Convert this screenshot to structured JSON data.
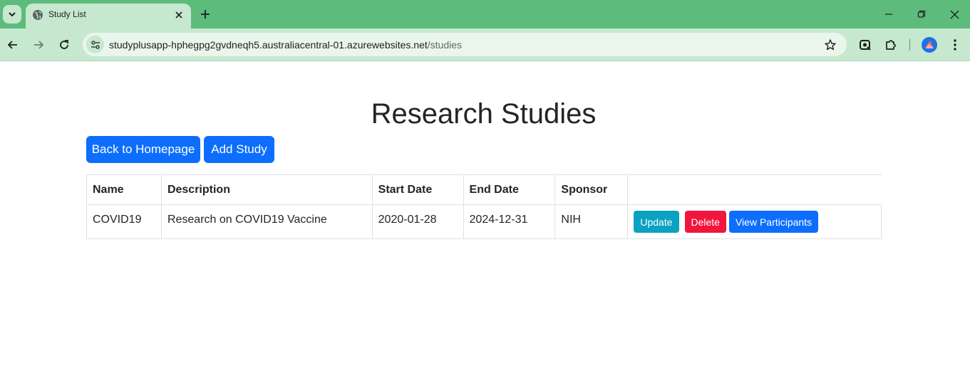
{
  "browser": {
    "tab_title": "Study List",
    "url_host": "studyplusapp-hphegpg2gvdneqh5.australiacentral-01.azurewebsites.net",
    "url_path": "/studies"
  },
  "page": {
    "title": "Research Studies",
    "back_button": "Back to Homepage",
    "add_button": "Add Study"
  },
  "table": {
    "headers": [
      "Name",
      "Description",
      "Start Date",
      "End Date",
      "Sponsor",
      ""
    ],
    "rows": [
      {
        "name": "COVID19",
        "description": "Research on COVID19 Vaccine",
        "start_date": "2020-01-28",
        "end_date": "2024-12-31",
        "sponsor": "NIH",
        "actions": {
          "update": "Update",
          "delete": "Delete",
          "view": "View Participants"
        }
      }
    ]
  },
  "colors": {
    "chrome": "#5dbb7c",
    "toolbar": "#c6e8cf",
    "primary": "#0d6efd",
    "info": "#0aa2c0",
    "danger": "#f0163e"
  }
}
